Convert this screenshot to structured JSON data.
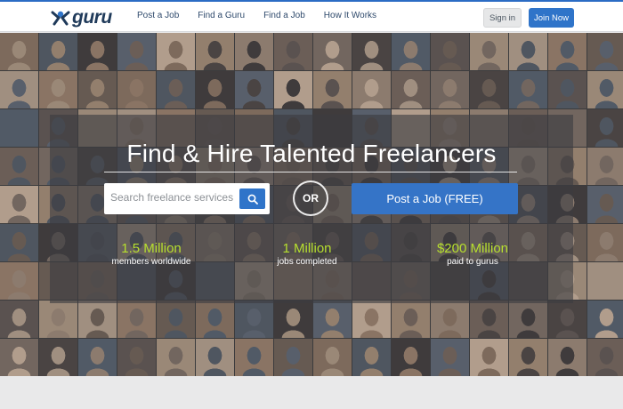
{
  "brand": {
    "name": "guru",
    "colors": {
      "accent": "#2f74c9",
      "stat_green": "#b7df2e",
      "nav_text": "#2f4a6c"
    }
  },
  "nav": {
    "items": [
      {
        "label": "Post a Job"
      },
      {
        "label": "Find a Guru"
      },
      {
        "label": "Find a Job"
      },
      {
        "label": "How It Works"
      }
    ],
    "signin_label": "Sign in",
    "join_label": "Join Now"
  },
  "hero": {
    "headline": "Find & Hire Talented Freelancers",
    "search": {
      "placeholder": "Search freelance services",
      "icon": "search-icon"
    },
    "or_label": "OR",
    "post_job_label": "Post a Job (FREE)",
    "stats": [
      {
        "value": "1.5 Million",
        "label": "members worldwide"
      },
      {
        "value": "1 Million",
        "label": "jobs completed"
      },
      {
        "value": "$200 Million",
        "label": "paid to gurus"
      }
    ],
    "background": "photo-mosaic-of-freelancers"
  }
}
